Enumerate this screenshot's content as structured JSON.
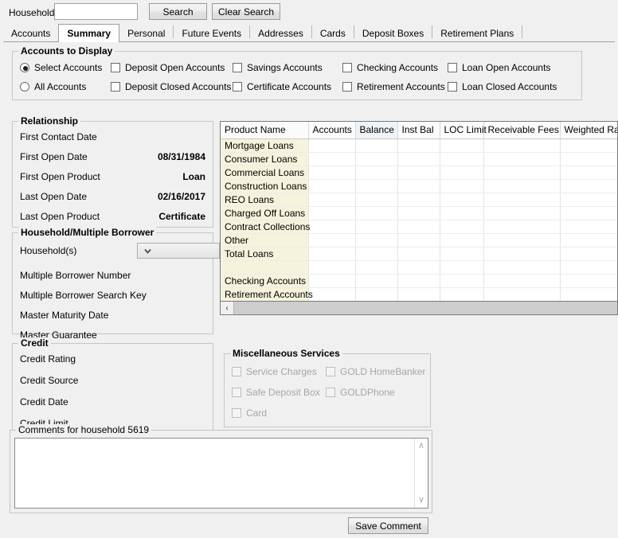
{
  "search": {
    "household_label": "Household",
    "household_value": "",
    "household_placeholder": "",
    "search_button": "Search",
    "clear_button": "Clear Search"
  },
  "tabs": [
    {
      "label": "Accounts",
      "active": false
    },
    {
      "label": "Summary",
      "active": true
    },
    {
      "label": "Personal",
      "active": false
    },
    {
      "label": "Future Events",
      "active": false
    },
    {
      "label": "Addresses",
      "active": false
    },
    {
      "label": "Cards",
      "active": false
    },
    {
      "label": "Deposit Boxes",
      "active": false
    },
    {
      "label": "Retirement Plans",
      "active": false
    }
  ],
  "accounts_to_display": {
    "title": "Accounts to Display",
    "radios": [
      {
        "label": "Select Accounts",
        "checked": true
      },
      {
        "label": "All Accounts",
        "checked": false
      }
    ],
    "checkboxes": [
      {
        "label": "Deposit Open Accounts",
        "checked": false
      },
      {
        "label": "Deposit Closed Accounts",
        "checked": false
      },
      {
        "label": "Savings Accounts",
        "checked": false
      },
      {
        "label": "Certificate Accounts",
        "checked": false
      },
      {
        "label": "Checking Accounts",
        "checked": false
      },
      {
        "label": "Retirement Accounts",
        "checked": false
      },
      {
        "label": "Loan Open Accounts",
        "checked": false
      },
      {
        "label": "Loan Closed Accounts",
        "checked": false
      }
    ]
  },
  "relationship": {
    "title": "Relationship",
    "fields": [
      {
        "label": "First Contact Date",
        "value": ""
      },
      {
        "label": "First Open Date",
        "value": "08/31/1984"
      },
      {
        "label": "First Open Product",
        "value": "Loan"
      },
      {
        "label": "Last Open Date",
        "value": "02/16/2017"
      },
      {
        "label": "Last Open Product",
        "value": "Certificate"
      }
    ]
  },
  "household_borrower": {
    "title": "Household/Multiple Borrower",
    "households_label": "Household(s)",
    "households_value": "",
    "fields": [
      {
        "label": "Multiple Borrower Number",
        "value": ""
      },
      {
        "label": "Multiple Borrower Search Key",
        "value": ""
      },
      {
        "label": "Master Maturity Date",
        "value": ""
      },
      {
        "label": "Master Guarantee",
        "value": ""
      }
    ]
  },
  "credit": {
    "title": "Credit",
    "fields": [
      {
        "label": "Credit Rating",
        "value": ""
      },
      {
        "label": "Credit Source",
        "value": ""
      },
      {
        "label": "Credit Date",
        "value": ""
      },
      {
        "label": "Credit Limit",
        "value": ""
      }
    ]
  },
  "misc_services": {
    "title": "Miscellaneous Services",
    "checkboxes": [
      {
        "label": "Service Charges",
        "checked": false,
        "disabled": true
      },
      {
        "label": "GOLD HomeBanker",
        "checked": false,
        "disabled": true
      },
      {
        "label": "Safe Deposit Box",
        "checked": false,
        "disabled": true
      },
      {
        "label": "GOLDPhone",
        "checked": false,
        "disabled": true
      },
      {
        "label": "Card",
        "checked": false,
        "disabled": true
      }
    ]
  },
  "grid": {
    "columns": [
      {
        "label": "Product Name",
        "selected": false
      },
      {
        "label": "Accounts",
        "selected": false
      },
      {
        "label": "Balance",
        "selected": true
      },
      {
        "label": "Inst Bal",
        "selected": false
      },
      {
        "label": "LOC Limit",
        "selected": false
      },
      {
        "label": "Receivable Fees",
        "selected": false
      },
      {
        "label": "Weighted Rate",
        "selected": false
      }
    ],
    "rows": [
      {
        "cells": [
          "Mortgage Loans",
          "",
          "",
          "",
          "",
          "",
          ""
        ]
      },
      {
        "cells": [
          "Consumer Loans",
          "",
          "",
          "",
          "",
          "",
          ""
        ]
      },
      {
        "cells": [
          "Commercial Loans",
          "",
          "",
          "",
          "",
          "",
          ""
        ]
      },
      {
        "cells": [
          "Construction Loans",
          "",
          "",
          "",
          "",
          "",
          ""
        ]
      },
      {
        "cells": [
          "REO Loans",
          "",
          "",
          "",
          "",
          "",
          ""
        ]
      },
      {
        "cells": [
          "Charged Off Loans",
          "",
          "",
          "",
          "",
          "",
          ""
        ]
      },
      {
        "cells": [
          "Contract Collections",
          "",
          "",
          "",
          "",
          "",
          ""
        ]
      },
      {
        "cells": [
          "Other",
          "",
          "",
          "",
          "",
          "",
          ""
        ]
      },
      {
        "cells": [
          "Total Loans",
          "",
          "",
          "",
          "",
          "",
          ""
        ]
      },
      {
        "cells": [
          "",
          "",
          "",
          "",
          "",
          "",
          ""
        ]
      },
      {
        "cells": [
          "Checking Accounts",
          "",
          "",
          "",
          "",
          "",
          ""
        ]
      },
      {
        "cells": [
          "Retirement Accounts",
          "",
          "",
          "",
          "",
          "",
          ""
        ]
      },
      {
        "cells": [
          "",
          "",
          "",
          "",
          "",
          "",
          ""
        ]
      }
    ],
    "scroll_left_icon": "‹"
  },
  "comments": {
    "title": "Comments for household 5619",
    "value": "",
    "placeholder": "",
    "scroll_up_icon": "∧",
    "scroll_down_icon": "∨",
    "save_button": "Save Comment"
  },
  "colors": {
    "window_bg": "#f0f0f0",
    "name_column_bg": "#f5f3dc",
    "selected_header_bg": "#eef3f8",
    "group_border": "#c6c6c6"
  }
}
